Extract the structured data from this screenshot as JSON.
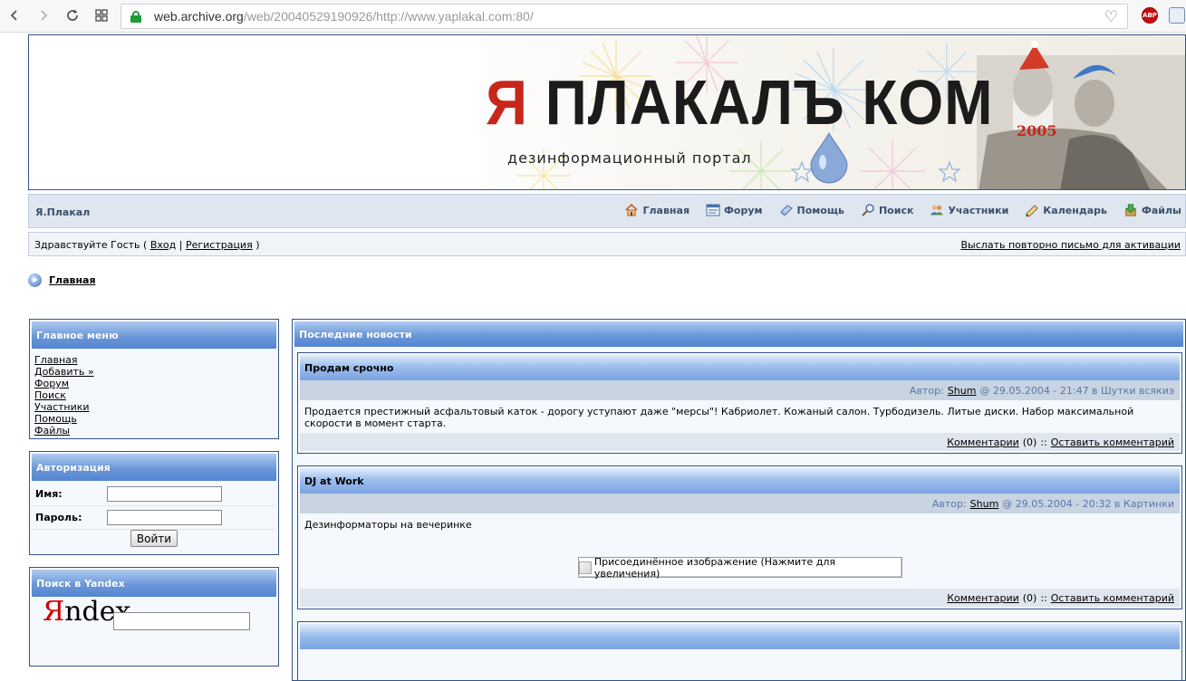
{
  "browser": {
    "url_host": "web.archive.org",
    "url_path": "/web/20040529190926/http://www.yaplakal.com:80/",
    "ext_abp": "ABP",
    "icons": [
      "back-icon",
      "forward-icon",
      "reload-icon",
      "apps-grid-icon",
      "lock-icon",
      "heart-icon"
    ]
  },
  "header": {
    "logo_red": "Я",
    "logo_rest": " ПЛАКАЛЪ КОМ",
    "subtitle": "дезинформационный портал",
    "year": "2005"
  },
  "navbar": {
    "brand": "Я.Плакал",
    "items": [
      {
        "label": "Главная",
        "icon": "home-icon"
      },
      {
        "label": "Форум",
        "icon": "forum-icon"
      },
      {
        "label": "Помощь",
        "icon": "help-icon"
      },
      {
        "label": "Поиск",
        "icon": "search-icon"
      },
      {
        "label": "Участники",
        "icon": "members-icon"
      },
      {
        "label": "Календарь",
        "icon": "calendar-icon"
      },
      {
        "label": "Файлы",
        "icon": "files-icon"
      }
    ]
  },
  "userbar": {
    "greeting": "Здравствуйте Гость (",
    "login": "Вход",
    "sep": "|",
    "register": "Регистрация",
    "close": ")",
    "resend": "Выслать повторно письмо для активации"
  },
  "breadcrumb": {
    "label": "Главная"
  },
  "sidebar": {
    "menu_title": "Главное меню",
    "menu_items": [
      "Главная",
      "Добавить »",
      "Форум",
      "Поиск",
      "Участники",
      "Помощь",
      "Файлы"
    ],
    "auth_title": "Авторизация",
    "name_label": "Имя:",
    "password_label": "Пароль:",
    "login_button": "Войти",
    "yandex_title": "Поиск в Yandex",
    "yandex_logo_first": "Я",
    "yandex_logo_rest": "ndex"
  },
  "news": {
    "section_title": "Последние новости",
    "items": [
      {
        "title": "Продам срочно",
        "author_prefix": "Автор:",
        "author": "Shum",
        "meta_suffix": "@ 29.05.2004 - 21:47 в Шутки всякиэ",
        "body": "Продается престижный асфальтовый каток - дорогу уступают даже \"мерсы\"! Кабриолет. Кожаный салон. Турбодизель. Литые диски. Набор максимальной скорости в момент старта.",
        "comments_label": "Комментарии",
        "comments_count": "(0)",
        "separator": "::",
        "leave_comment": "Оставить комментарий"
      },
      {
        "title": "DJ at Work",
        "author_prefix": "Автор:",
        "author": "Shum",
        "meta_suffix": "@ 29.05.2004 - 20:32 в Картинки",
        "body": "Дезинформаторы на вечеринке",
        "image_alt": "Присоединённое изображение (Нажмите для увеличения)",
        "comments_label": "Комментарии",
        "comments_count": "(0)",
        "separator": "::",
        "leave_comment": "Оставить комментарий"
      }
    ]
  }
}
